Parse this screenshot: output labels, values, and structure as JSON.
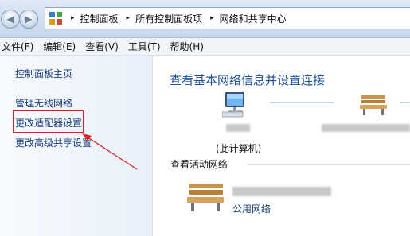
{
  "addressbar": {
    "back_glyph": "◀",
    "forward_glyph": "▶",
    "breadcrumbs": [
      "控制面板",
      "所有控制面板项",
      "网络和共享中心"
    ],
    "separator": "▸"
  },
  "menubar": {
    "items": [
      "文件(F)",
      "编辑(E)",
      "查看(V)",
      "工具(T)",
      "帮助(H)"
    ]
  },
  "sidebar": {
    "items": [
      {
        "label": "控制面板主页"
      },
      {
        "label": "管理无线网络"
      },
      {
        "label": "更改适配器设置"
      },
      {
        "label": "更改高级共享设置"
      }
    ],
    "highlighted_index": 2,
    "highlight_color": "#e02020"
  },
  "main": {
    "title": "查看基本网络信息并设置连接",
    "computer_label": "(此计算机)",
    "active_networks_title": "查看活动网络",
    "network_type_link": "公用网络"
  },
  "colors": {
    "link": "#1a3f7a",
    "title": "#1c4e9a",
    "annotation": "#e02020"
  },
  "icons": [
    "back-arrow-icon",
    "forward-arrow-icon",
    "control-panel-icon",
    "computer-icon",
    "bench-icon"
  ]
}
